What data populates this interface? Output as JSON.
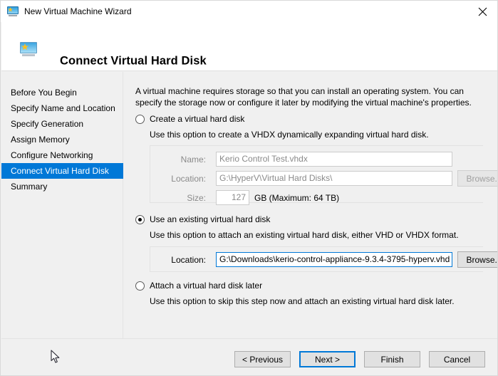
{
  "window": {
    "title": "New Virtual Machine Wizard",
    "title_icon": "virtual-machine-icon",
    "close_icon": "close-icon"
  },
  "header": {
    "icon": "virtual-machine-icon",
    "title": "Connect Virtual Hard Disk"
  },
  "sidebar": {
    "items": [
      {
        "label": "Before You Begin",
        "selected": false
      },
      {
        "label": "Specify Name and Location",
        "selected": false
      },
      {
        "label": "Specify Generation",
        "selected": false
      },
      {
        "label": "Assign Memory",
        "selected": false
      },
      {
        "label": "Configure Networking",
        "selected": false
      },
      {
        "label": "Connect Virtual Hard Disk",
        "selected": true
      },
      {
        "label": "Summary",
        "selected": false
      }
    ],
    "selected_color": "#0078d7"
  },
  "main": {
    "intro": "A virtual machine requires storage so that you can install an operating system. You can specify the storage now or configure it later by modifying the virtual machine's properties.",
    "options": [
      {
        "label": "Create a virtual hard disk",
        "description": "Use this option to create a VHDX dynamically expanding virtual hard disk.",
        "selected": false,
        "enabled": false
      },
      {
        "label": "Use an existing virtual hard disk",
        "description": "Use this option to attach an existing virtual hard disk, either VHD or VHDX format.",
        "selected": true,
        "enabled": true
      },
      {
        "label": "Attach a virtual hard disk later",
        "description": "Use this option to skip this step now and attach an existing virtual hard disk later.",
        "selected": false,
        "enabled": false
      }
    ],
    "create_group": {
      "name_label": "Name:",
      "name_value": "Kerio Control Test.vhdx",
      "location_label": "Location:",
      "location_value": "G:\\HyperV\\Virtual Hard Disks\\",
      "browse_label": "Browse...",
      "size_label": "Size:",
      "size_value": "127",
      "size_suffix": "GB (Maximum: 64 TB)"
    },
    "existing_group": {
      "location_label": "Location:",
      "location_value": "G:\\Downloads\\kerio-control-appliance-9.3.4-3795-hyperv.vhd",
      "browse_label": "Browse...",
      "focus_color": "#0078d7"
    }
  },
  "footer": {
    "buttons": [
      {
        "label": "< Previous",
        "default": false
      },
      {
        "label": "Next >",
        "default": true
      },
      {
        "label": "Finish",
        "default": false
      },
      {
        "label": "Cancel",
        "default": false
      }
    ]
  }
}
